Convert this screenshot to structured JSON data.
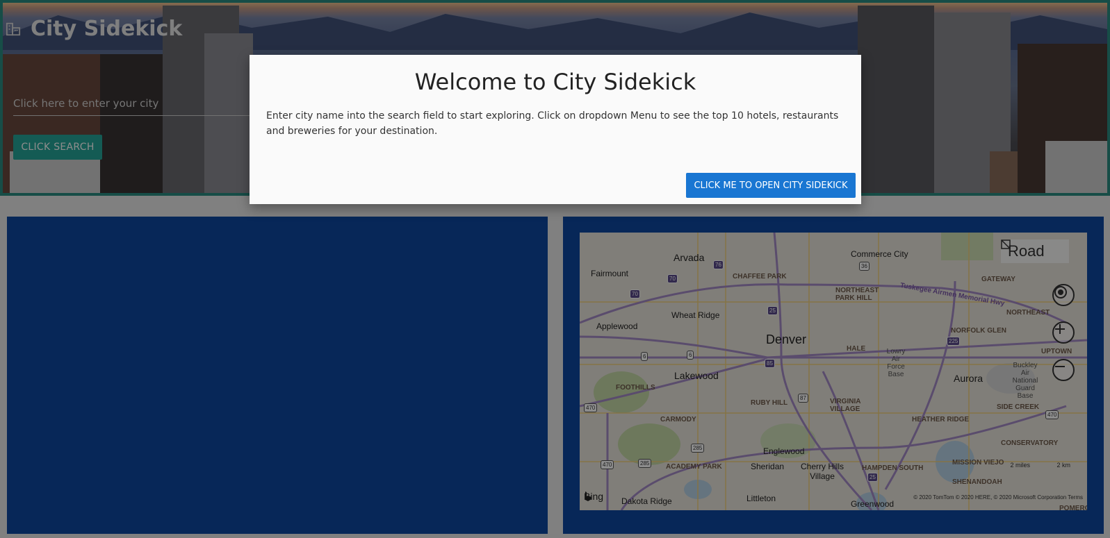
{
  "header": {
    "brand_title": "City Sidekick",
    "brand_icon": "city-icon",
    "city_input": {
      "placeholder": "Click here to enter your city",
      "value": ""
    },
    "search_button": "CLICK SEARCH"
  },
  "modal": {
    "title": "Welcome to City Sidekick",
    "body": "Enter city name into the search field to start exploring. Click on dropdown Menu to see the top 10 hotels, restaurants and breweries for your destination.",
    "button": "CLICK ME TO OPEN CITY SIDEKICK"
  },
  "map": {
    "style_toggle": "Road",
    "controls": {
      "locate_icon": "locate-icon",
      "zoom_in_icon": "plus-icon",
      "zoom_out_icon": "minus-icon"
    },
    "scale_miles": "2 miles",
    "scale_km": "2 km",
    "copyright": "© 2020 TomTom © 2020 HERE, © 2020 Microsoft Corporation  Terms",
    "bing": "Bing",
    "labels": {
      "arvada": "Arvada",
      "commerce_city": "Commerce City",
      "fairmount": "Fairmount",
      "chaffee_park": "CHAFFEE PARK",
      "gateway": "GATEWAY",
      "northeast_park_hill": "NORTHEAST PARK HILL",
      "tuskegee": "Tuskegee Airmen Memorial Hwy",
      "wheat_ridge": "Wheat Ridge",
      "northeast": "NORTHEAST",
      "applewood": "Applewood",
      "norfolk_glen": "NORFOLK GLEN",
      "denver": "Denver",
      "hale": "HALE",
      "lowry": "Lowry Air Force Base",
      "uptown": "UPTOWN",
      "buckley": "Buckley Air National Guard Base",
      "lakewood": "Lakewood",
      "aurora": "Aurora",
      "foothills": "FOOTHILLS",
      "ruby_hill": "RUBY HILL",
      "virginia_village": "VIRGINIA VILLAGE",
      "side_creek": "SIDE CREEK",
      "carmody": "CARMODY",
      "heather_ridge": "HEATHER RIDGE",
      "conservatory": "CONSERVATORY",
      "englewood": "Englewood",
      "mission_viejo": "MISSION VIEJO",
      "academy_park": "ACADEMY PARK",
      "sheridan": "Sheridan",
      "cherry_hills": "Cherry Hills Village",
      "hampden_south": "HAMPDEN SOUTH",
      "shenandoah": "SHENANDOAH",
      "dakota_ridge": "Dakota Ridge",
      "littleton": "Littleton",
      "greenwood": "Greenwood",
      "pomeroy": "POMEROY"
    },
    "shields": [
      "76",
      "70",
      "70",
      "36",
      "25",
      "225",
      "6",
      "6",
      "85",
      "87",
      "470",
      "285",
      "285",
      "470",
      "25",
      "470"
    ]
  }
}
